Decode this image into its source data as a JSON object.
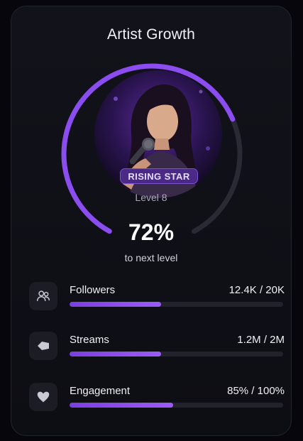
{
  "card": {
    "title": "Artist Growth",
    "badge": "RISING STAR",
    "level": "Level 8",
    "progress_percent_text": "72%",
    "progress_fraction": 0.72,
    "next_level_text": "to next level"
  },
  "stats": [
    {
      "label": "Followers",
      "value": "12.4K / 20K",
      "fraction": 0.43,
      "icon": "users-icon"
    },
    {
      "label": "Streams",
      "value": "1.2M / 2M",
      "fraction": 0.43,
      "icon": "play-icon"
    },
    {
      "label": "Engagement",
      "value": "85% / 100%",
      "fraction": 0.485,
      "icon": "heart-icon"
    }
  ],
  "colors": {
    "accent": "#8b4cf0",
    "track": "#2a2a34",
    "background": "#06060c"
  }
}
